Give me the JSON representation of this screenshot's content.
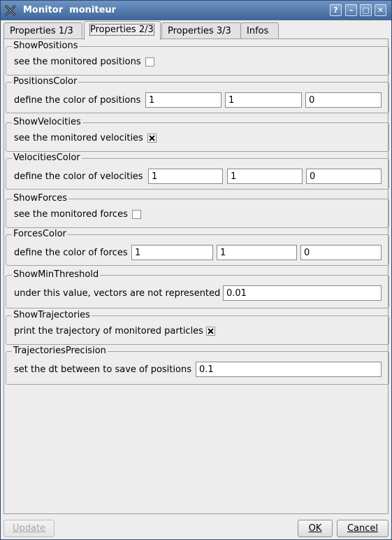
{
  "window": {
    "title": "Monitor  moniteur",
    "buttons": {
      "help": "?",
      "minimize": "–",
      "maximize": "□",
      "close": "✕"
    }
  },
  "tabs": [
    {
      "label": "Properties 1/3",
      "active": false
    },
    {
      "label": "Properties 2/3",
      "active": true
    },
    {
      "label": "Properties 3/3",
      "active": false
    },
    {
      "label": "Infos",
      "active": false
    }
  ],
  "groups": {
    "show_positions": {
      "title": "ShowPositions",
      "label": "see the monitored positions",
      "checked": false
    },
    "positions_color": {
      "title": "PositionsColor",
      "label": "define the color of positions",
      "values": [
        "1",
        "1",
        "0"
      ]
    },
    "show_velocities": {
      "title": "ShowVelocities",
      "label": "see the monitored velocities",
      "checked": true
    },
    "velocities_color": {
      "title": "VelocitiesColor",
      "label": "define the color of velocities",
      "values": [
        "1",
        "1",
        "0"
      ]
    },
    "show_forces": {
      "title": "ShowForces",
      "label": "see the monitored forces",
      "checked": false
    },
    "forces_color": {
      "title": "ForcesColor",
      "label": "define the color of forces",
      "values": [
        "1",
        "1",
        "0"
      ]
    },
    "show_min_threshold": {
      "title": "ShowMinThreshold",
      "label": "under this value, vectors are not represented",
      "value": "0.01"
    },
    "show_trajectories": {
      "title": "ShowTrajectories",
      "label": "print the trajectory of monitored particles",
      "checked": true
    },
    "trajectories_precision": {
      "title": "TrajectoriesPrecision",
      "label": "set the dt between to save of positions",
      "value": "0.1"
    }
  },
  "buttons": {
    "update": {
      "label": "Update",
      "enabled": false
    },
    "ok": {
      "label": "OK"
    },
    "cancel": {
      "label": "Cancel"
    }
  },
  "colors": {
    "titlebar": "#3d6598",
    "background": "#ededed"
  }
}
